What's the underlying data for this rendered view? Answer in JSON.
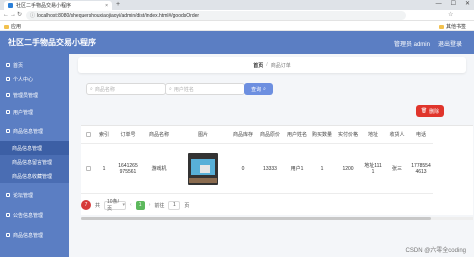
{
  "browser": {
    "tab_title": "社区二手物品交易小程序",
    "tab_close": "×",
    "new_tab": "+",
    "window_controls": [
      "—",
      "☐",
      "✕"
    ],
    "nav": [
      "←",
      "→",
      "↻"
    ],
    "url": "localhost:8080/shequershouxiaojiaoyi/admin/dist/index.html#/goodsOrder",
    "bookmarks_left": "应用",
    "bookmarks_right": "其他书签"
  },
  "app": {
    "title": "社区二手物品交易小程序",
    "user_label": "管理员 admin",
    "logout": "退出登录"
  },
  "sidebar": {
    "items": [
      {
        "label": "首页"
      },
      {
        "label": "个人中心"
      },
      {
        "label": "管理员管理"
      },
      {
        "label": "用户管理"
      },
      {
        "label": "商品信息管理"
      },
      {
        "label": "商品信息管理"
      },
      {
        "label": "商品信息留言管理"
      },
      {
        "label": "商品信息收藏管理"
      },
      {
        "label": "论坛管理"
      },
      {
        "label": "公告信息管理"
      },
      {
        "label": "商品信息管理"
      }
    ]
  },
  "breadcrumb": {
    "home": "首页",
    "sep": "/",
    "current": "商品订单"
  },
  "filters": {
    "search1_placeholder": "商品名称",
    "search2_placeholder": "用户姓名",
    "query_button": "查询",
    "delete_button": "删除"
  },
  "table": {
    "headers": [
      "",
      "索引",
      "订单号",
      "商品名称",
      "图片",
      "商品库存",
      "商品原价",
      "用户姓名",
      "购买数量",
      "实付价格",
      "地址",
      "收货人",
      "电话"
    ],
    "rows": [
      {
        "index": "1",
        "order_no": "1641265\n975561",
        "goods_name": "游戏机",
        "stock": "0",
        "price": "13333",
        "user": "用户1",
        "qty": "1",
        "paid": "1200",
        "address": "地址111\n1",
        "consignee": "张三",
        "phone": "1778554\n4613"
      }
    ]
  },
  "pager": {
    "badge": "7",
    "total": "共",
    "page_size": "10条/页",
    "prev": "‹",
    "current": "1",
    "next": "›",
    "goto_label": "前往",
    "goto_value": "1",
    "page_unit": "页"
  },
  "watermark": "CSDN @六零全coding"
}
